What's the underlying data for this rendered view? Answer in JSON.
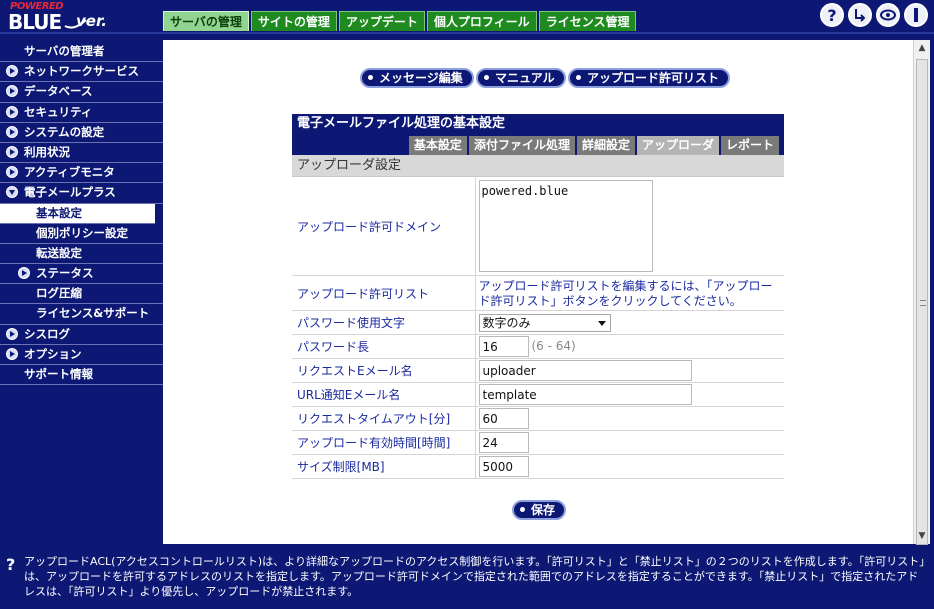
{
  "logo": {
    "powered": "POWERED",
    "blue": "BLUE",
    "version": "ver."
  },
  "top_tabs": [
    "サーバの管理",
    "サイトの管理",
    "アップデート",
    "個人プロフィール",
    "ライセンス管理"
  ],
  "header_icons": [
    "help-icon",
    "logout-icon",
    "view-icon",
    "info-icon"
  ],
  "sidebar": {
    "items": [
      {
        "label": "サーバの管理者",
        "arrow": false
      },
      {
        "label": "ネットワークサービス",
        "arrow": true
      },
      {
        "label": "データベース",
        "arrow": true
      },
      {
        "label": "セキュリティ",
        "arrow": true
      },
      {
        "label": "システムの設定",
        "arrow": true
      },
      {
        "label": "利用状況",
        "arrow": true
      },
      {
        "label": "アクティブモニタ",
        "arrow": true
      },
      {
        "label": "電子メールプラス",
        "arrow": true
      },
      {
        "label": "基本設定",
        "arrow": false
      },
      {
        "label": "個別ポリシー設定",
        "arrow": false
      },
      {
        "label": "転送設定",
        "arrow": false
      },
      {
        "label": "ステータス",
        "arrow": true
      },
      {
        "label": "ログ圧縮",
        "arrow": false
      },
      {
        "label": "ライセンス&サポート",
        "arrow": false
      },
      {
        "label": "シスログ",
        "arrow": true
      },
      {
        "label": "オプション",
        "arrow": true
      },
      {
        "label": "サポート情報",
        "arrow": false
      }
    ]
  },
  "actions": {
    "message_edit": "メッセージ編集",
    "manual": "マニュアル",
    "upload_allow_list": "アップロード許可リスト"
  },
  "panel": {
    "title": "電子メールファイル処理の基本設定",
    "tabs": [
      "基本設定",
      "添付ファイル処理",
      "詳細設定",
      "アップローダ",
      "レポート"
    ],
    "section_title": "アップローダ設定"
  },
  "form": {
    "upload_domain": {
      "label": "アップロード許可ドメイン",
      "value": "powered.blue"
    },
    "upload_list": {
      "label": "アップロード許可リスト",
      "hint": "アップロード許可リストを編集するには、「アップロード許可リスト」ボタンをクリックしてください。"
    },
    "password_chars": {
      "label": "パスワード使用文字",
      "value": "数字のみ"
    },
    "password_length": {
      "label": "パスワード長",
      "value": "16",
      "range": "(6 - 64)"
    },
    "request_email": {
      "label": "リクエストEメール名",
      "value": "uploader"
    },
    "url_notify_email": {
      "label": "URL通知Eメール名",
      "value": "template"
    },
    "request_timeout": {
      "label": "リクエストタイムアウト[分]",
      "value": "60"
    },
    "upload_valid_time": {
      "label": "アップロード有効時間[時間]",
      "value": "24"
    },
    "size_limit": {
      "label": "サイズ制限[MB]",
      "value": "5000"
    }
  },
  "save_label": "保存",
  "help_text": "アップロードACL(アクセスコントロールリスト)は、より詳細なアップロードのアクセス制御を行います。「許可リスト」と「禁止リスト」の２つのリストを作成します。「許可リスト」は、アップロードを許可するアドレスのリストを指定します。アップロード許可ドメインで指定された範囲でのアドレスを指定することができます。「禁止リスト」で指定されたアドレスは、「許可リスト」より優先し、アップロードが禁止されます。",
  "colors": {
    "navy": "#0c1874",
    "tab_green": "#1f8a1f",
    "label_blue": "#1a2aa0"
  }
}
